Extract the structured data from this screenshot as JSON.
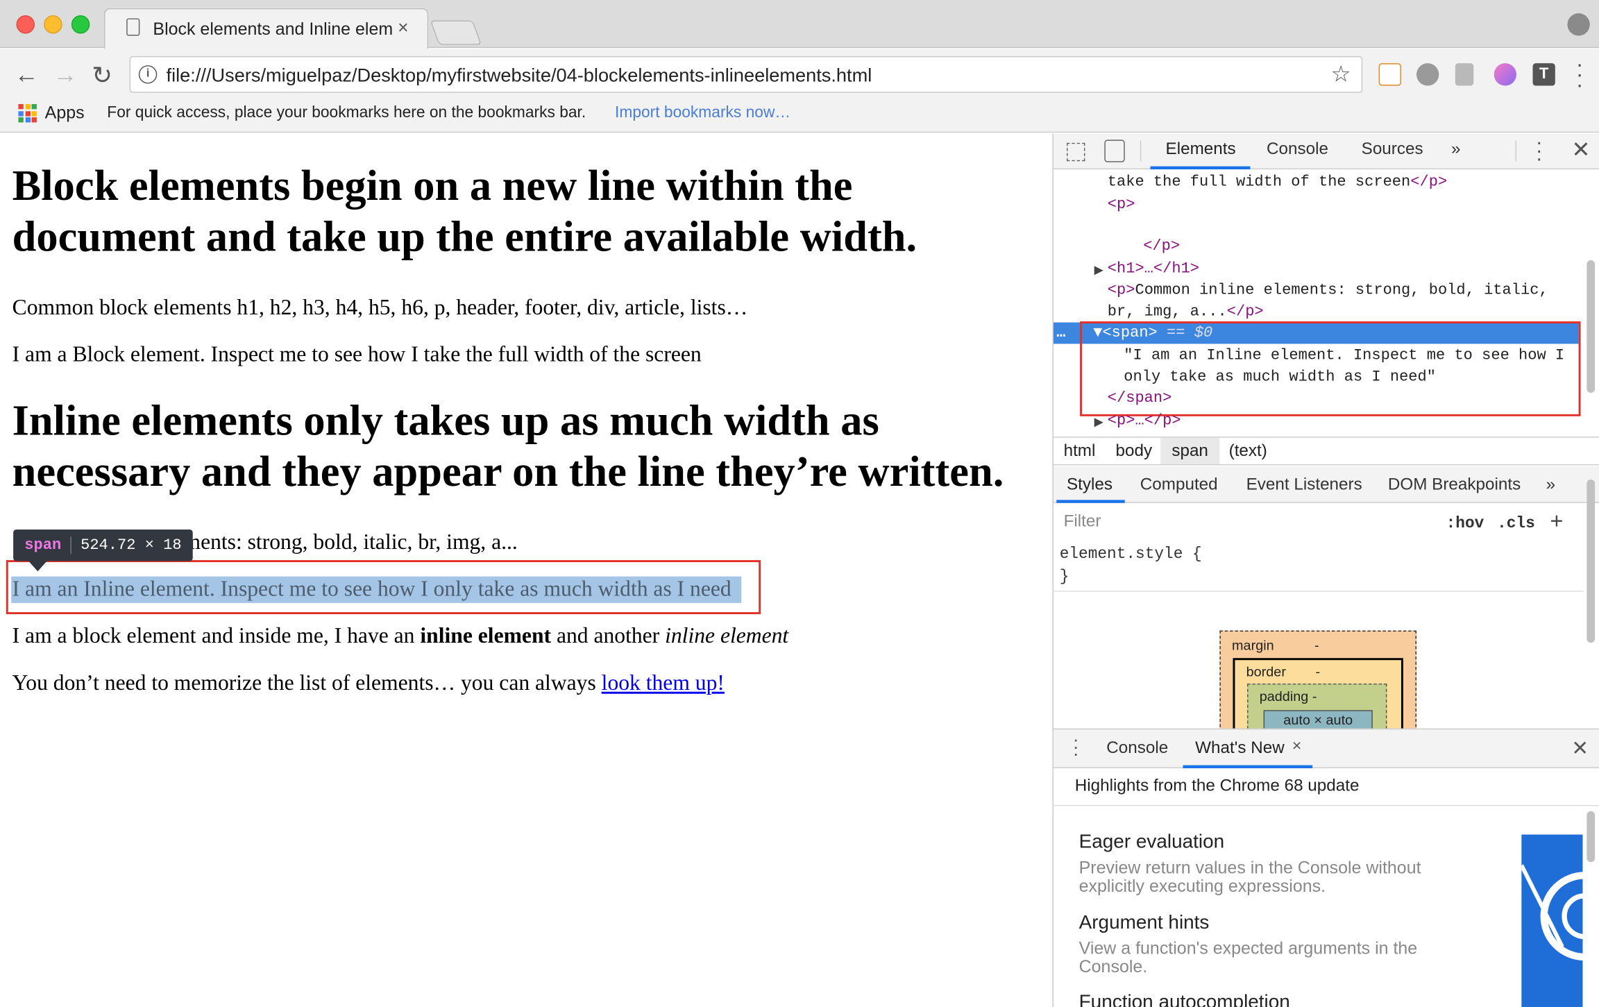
{
  "browser": {
    "tab_title": "Block elements and Inline elem",
    "tab_close": "×",
    "url": "file:///Users/miguelpaz/Desktop/myfirstwebsite/04-blockelements-inlineelements.html",
    "bookmarks": {
      "apps_label": "Apps",
      "message": "For quick access, place your bookmarks here on the bookmarks bar.",
      "import_link": "Import bookmarks now…"
    }
  },
  "page": {
    "heading1_line1": "Block elements begin on a new line within the",
    "heading1_line2": "document and take up the entire available width.",
    "para1": "Common block elements h1, h2, h3, h4, h5, h6, p, header, footer, div, article, lists…",
    "para2": "I am a Block element. Inspect me to see how I take the full width of the screen",
    "heading2_line1": "Inline elements only takes up as much width as",
    "heading2_line2": "necessary and they appear on the line they’re written.",
    "para3_visible": "ments: strong, bold, italic, br, img, a...",
    "span_text": "I am an Inline element. Inspect me to see how I only take as much width as I need",
    "para4_start": "I am a block element and inside me, I have an ",
    "para4_bold": "inline element",
    "para4_mid": " and another ",
    "para4_italic": "inline element",
    "para5_start": "You don’t need to memorize the list of elements… you can always ",
    "para5_link": "look them up!",
    "tooltip_tag": "span",
    "tooltip_size": "524.72 × 18"
  },
  "devtools": {
    "tabs": [
      "Elements",
      "Console",
      "Sources",
      "»"
    ],
    "dom": {
      "line1_text": "take the full width of the screen",
      "line1_close": "</p>",
      "line2": "<p>",
      "line3": "</p>",
      "line4": "<h1>…</h1>",
      "line5_open": "<p>",
      "line5_text": "Common inline elements: strong, bold, italic,",
      "line6_text": "br, img, a...",
      "line6_close": "</p>",
      "sel_dots": "…",
      "sel_tag": "▼<span>",
      "sel_eq": " == ",
      "sel_var": "$0",
      "text_line1": "\"I am an Inline element. Inspect me to see how I",
      "text_line2": "only take as much width as I need\"",
      "close_span": "</span>",
      "last_line": "<p>…</p>"
    },
    "breadcrumbs": [
      "html",
      "body",
      "span",
      "(text)"
    ],
    "styles_tabs": [
      "Styles",
      "Computed",
      "Event Listeners",
      "DOM Breakpoints",
      "»"
    ],
    "filter_placeholder": "Filter",
    "hov": ":hov",
    "cls": ".cls",
    "plus": "+",
    "element_style_open": "element.style {",
    "element_style_close": "}",
    "box_model": {
      "margin_label": "margin",
      "margin_value": "-",
      "border_label": "border",
      "border_value": "-",
      "padding_label": "padding -",
      "content": "auto × auto"
    },
    "drawer": {
      "tabs": [
        "Console",
        "What's New"
      ],
      "close": "×",
      "highlights": "Highlights from the Chrome 68 update",
      "items": [
        {
          "title": "Eager evaluation",
          "desc": "Preview return values in the Console without explicitly executing expressions."
        },
        {
          "title": "Argument hints",
          "desc": "View a function's expected arguments in the Console."
        },
        {
          "title": "Function autocompletion",
          "desc": ""
        }
      ]
    }
  },
  "colors": {
    "highlight": "#a4c5e6",
    "annotation_red": "#e0322a",
    "devtools_blue": "#1a73e8",
    "tag_purple": "#881280"
  }
}
